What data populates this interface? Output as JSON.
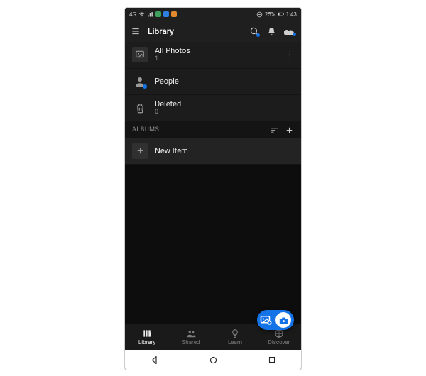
{
  "status": {
    "net_label": "4G",
    "dnd_icon": "dnd-icon",
    "battery_text": "25%",
    "time": "1:43"
  },
  "header": {
    "title": "Library"
  },
  "rows": {
    "all_photos": {
      "label": "All Photos",
      "count": "1"
    },
    "people": {
      "label": "People"
    },
    "deleted": {
      "label": "Deleted",
      "count": "0"
    }
  },
  "sections": {
    "albums_label": "ALBUMS",
    "new_item": {
      "label": "New Item"
    }
  },
  "bottomnav": {
    "library": "Library",
    "shared": "Shared",
    "learn": "Learn",
    "discover": "Discover"
  }
}
